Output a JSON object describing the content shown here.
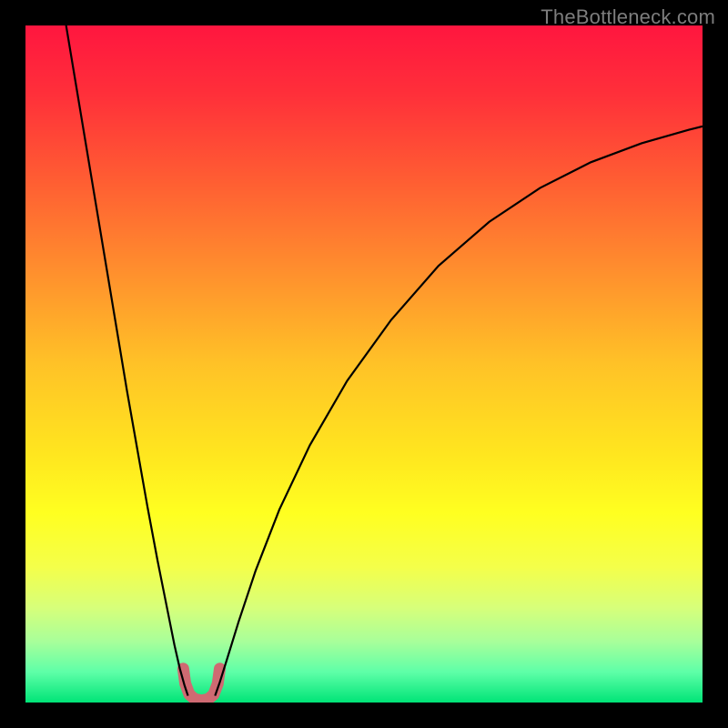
{
  "watermark": "TheBottleneck.com",
  "chart_data": {
    "type": "line",
    "title": "",
    "xlabel": "",
    "ylabel": "",
    "xlim": [
      0,
      100
    ],
    "ylim": [
      0,
      100
    ],
    "grid": false,
    "legend": false,
    "annotations": [],
    "gradient_stops": [
      {
        "offset": 0.0,
        "color": "#ff163f"
      },
      {
        "offset": 0.1,
        "color": "#ff2f3a"
      },
      {
        "offset": 0.22,
        "color": "#ff5a33"
      },
      {
        "offset": 0.35,
        "color": "#ff8a2e"
      },
      {
        "offset": 0.5,
        "color": "#ffc227"
      },
      {
        "offset": 0.63,
        "color": "#ffe51f"
      },
      {
        "offset": 0.72,
        "color": "#ffff20"
      },
      {
        "offset": 0.8,
        "color": "#f4ff4a"
      },
      {
        "offset": 0.86,
        "color": "#d7ff7a"
      },
      {
        "offset": 0.91,
        "color": "#a8ff9a"
      },
      {
        "offset": 0.955,
        "color": "#5effa8"
      },
      {
        "offset": 1.0,
        "color": "#00e477"
      }
    ],
    "series": [
      {
        "name": "left-branch",
        "stroke": "#000000",
        "stroke_width": 2.2,
        "x": [
          6.0,
          7.5,
          9.0,
          10.5,
          12.0,
          13.5,
          15.0,
          16.5,
          18.0,
          19.5,
          21.0,
          22.0,
          22.8,
          23.5,
          24.0
        ],
        "y": [
          100,
          91,
          82,
          73,
          64,
          55,
          46,
          37.5,
          29,
          21,
          13.5,
          8.5,
          5.0,
          2.5,
          1.0
        ]
      },
      {
        "name": "right-branch",
        "stroke": "#000000",
        "stroke_width": 2.2,
        "x": [
          28.0,
          28.7,
          29.8,
          31.5,
          34.0,
          37.5,
          42.0,
          47.5,
          54.0,
          61.0,
          68.5,
          76.0,
          83.5,
          91.0,
          98.0,
          100.0
        ],
        "y": [
          1.0,
          3.0,
          6.5,
          12.0,
          19.5,
          28.5,
          38.0,
          47.5,
          56.5,
          64.5,
          71.0,
          76.0,
          79.8,
          82.6,
          84.6,
          85.1
        ]
      },
      {
        "name": "valley-highlight",
        "stroke": "#cf6a72",
        "stroke_width": 13,
        "linecap": "round",
        "x": [
          23.3,
          23.6,
          24.2,
          25.0,
          26.0,
          27.0,
          27.8,
          28.4,
          28.7
        ],
        "y": [
          5.0,
          2.8,
          1.2,
          0.5,
          0.3,
          0.5,
          1.2,
          2.8,
          5.0
        ]
      }
    ]
  }
}
